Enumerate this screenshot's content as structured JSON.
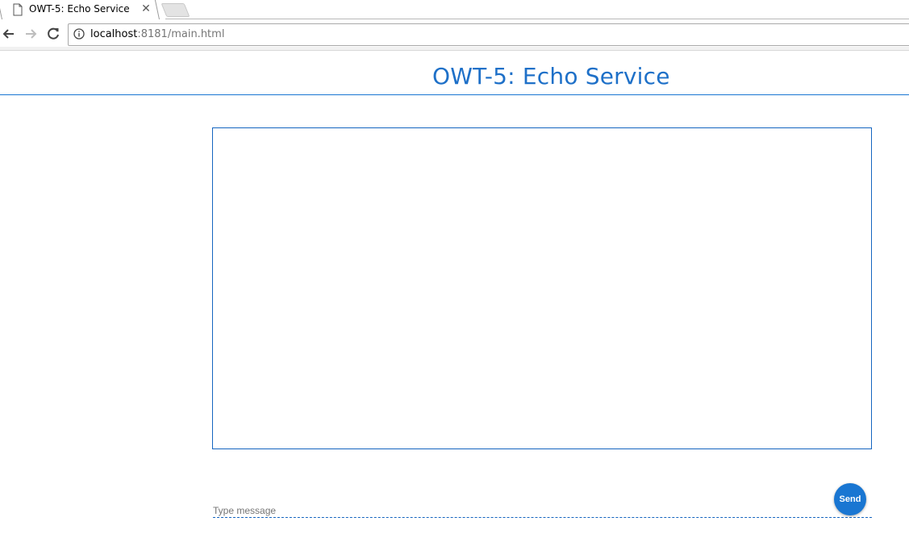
{
  "browser": {
    "tab": {
      "title": "OWT-5: Echo Service",
      "close_glyph": "✕",
      "icon": "page-icon"
    },
    "address_bar": {
      "host": "localhost",
      "rest": ":8181/main.html",
      "icon": "info-icon"
    },
    "nav_icons": [
      "back-arrow-icon",
      "forward-arrow-icon",
      "reload-icon"
    ]
  },
  "page": {
    "title": "OWT-5: Echo Service",
    "message_input": {
      "placeholder": "Type message",
      "value": ""
    },
    "send_button": {
      "label": "Send"
    }
  },
  "colors": {
    "accent": "#1976d2",
    "title": "#1e70c8"
  }
}
